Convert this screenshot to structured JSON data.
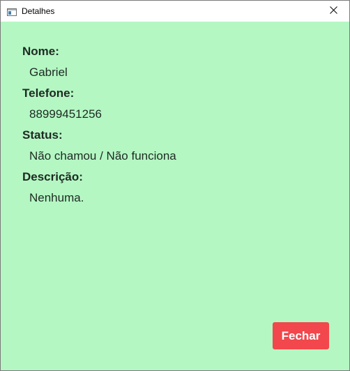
{
  "window": {
    "title": "Detalhes",
    "app_icon": "window-app-icon",
    "close_icon": "close-icon",
    "background_color": "#b4f7c3"
  },
  "fields": [
    {
      "label": "Nome:",
      "value": "Gabriel"
    },
    {
      "label": "Telefone:",
      "value": "88999451256"
    },
    {
      "label": "Status:",
      "value": "Não chamou / Não funciona"
    },
    {
      "label": "Descrição:",
      "value": "Nenhuma."
    }
  ],
  "actions": {
    "close_label": "Fechar",
    "close_color": "#f2474c"
  }
}
